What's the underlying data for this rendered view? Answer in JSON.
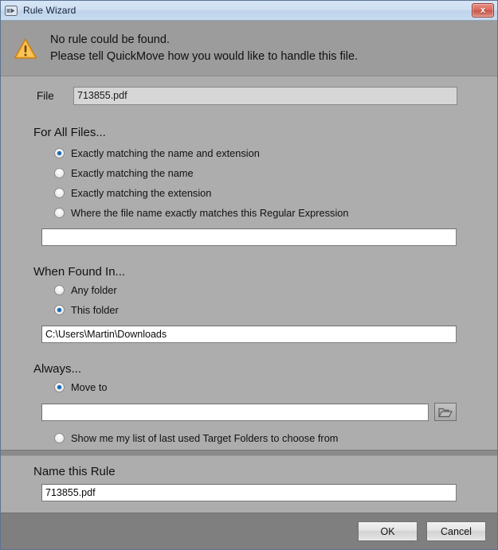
{
  "window": {
    "title": "Rule Wizard",
    "icon": "move-arrow-icon",
    "close_label": "x"
  },
  "header": {
    "icon": "warning-triangle-icon",
    "line1": "No rule could be found.",
    "line2": "Please tell QuickMove how you would like to handle this file."
  },
  "file_row": {
    "label": "File",
    "value": "713855.pdf",
    "placeholder": ""
  },
  "for_all_files": {
    "title": "For All Files...",
    "options": [
      {
        "label": "Exactly matching the name and extension",
        "checked": true
      },
      {
        "label": "Exactly matching the name",
        "checked": false
      },
      {
        "label": "Exactly matching the extension",
        "checked": false
      },
      {
        "label": "Where the file name exactly matches this Regular Expression",
        "checked": false
      }
    ],
    "regex_value": "",
    "regex_placeholder": ""
  },
  "when_found_in": {
    "title": "When Found In...",
    "options": [
      {
        "label": "Any folder",
        "checked": false
      },
      {
        "label": "This folder",
        "checked": true
      }
    ],
    "folder_value": "C:\\Users\\Martin\\Downloads",
    "folder_placeholder": ""
  },
  "always": {
    "title": "Always...",
    "options": [
      {
        "label": "Move to",
        "checked": true
      },
      {
        "label": "Show me my list of last used Target Folders to choose from",
        "checked": false
      }
    ],
    "target_value": "",
    "target_placeholder": "",
    "browse_icon": "folder-open-icon"
  },
  "name_rule": {
    "title": "Name this Rule",
    "value": "713855.pdf",
    "placeholder": ""
  },
  "footer": {
    "ok_label": "OK",
    "cancel_label": "Cancel"
  },
  "colors": {
    "body_gray": "#adadad",
    "header_gray": "#9c9c9c",
    "footer_gray": "#7f7f7f",
    "radio_accent": "#1569b8",
    "warning_orange": "#f5a623",
    "close_red": "#d9695c",
    "titlebar_blue": "#cfe0f2"
  }
}
